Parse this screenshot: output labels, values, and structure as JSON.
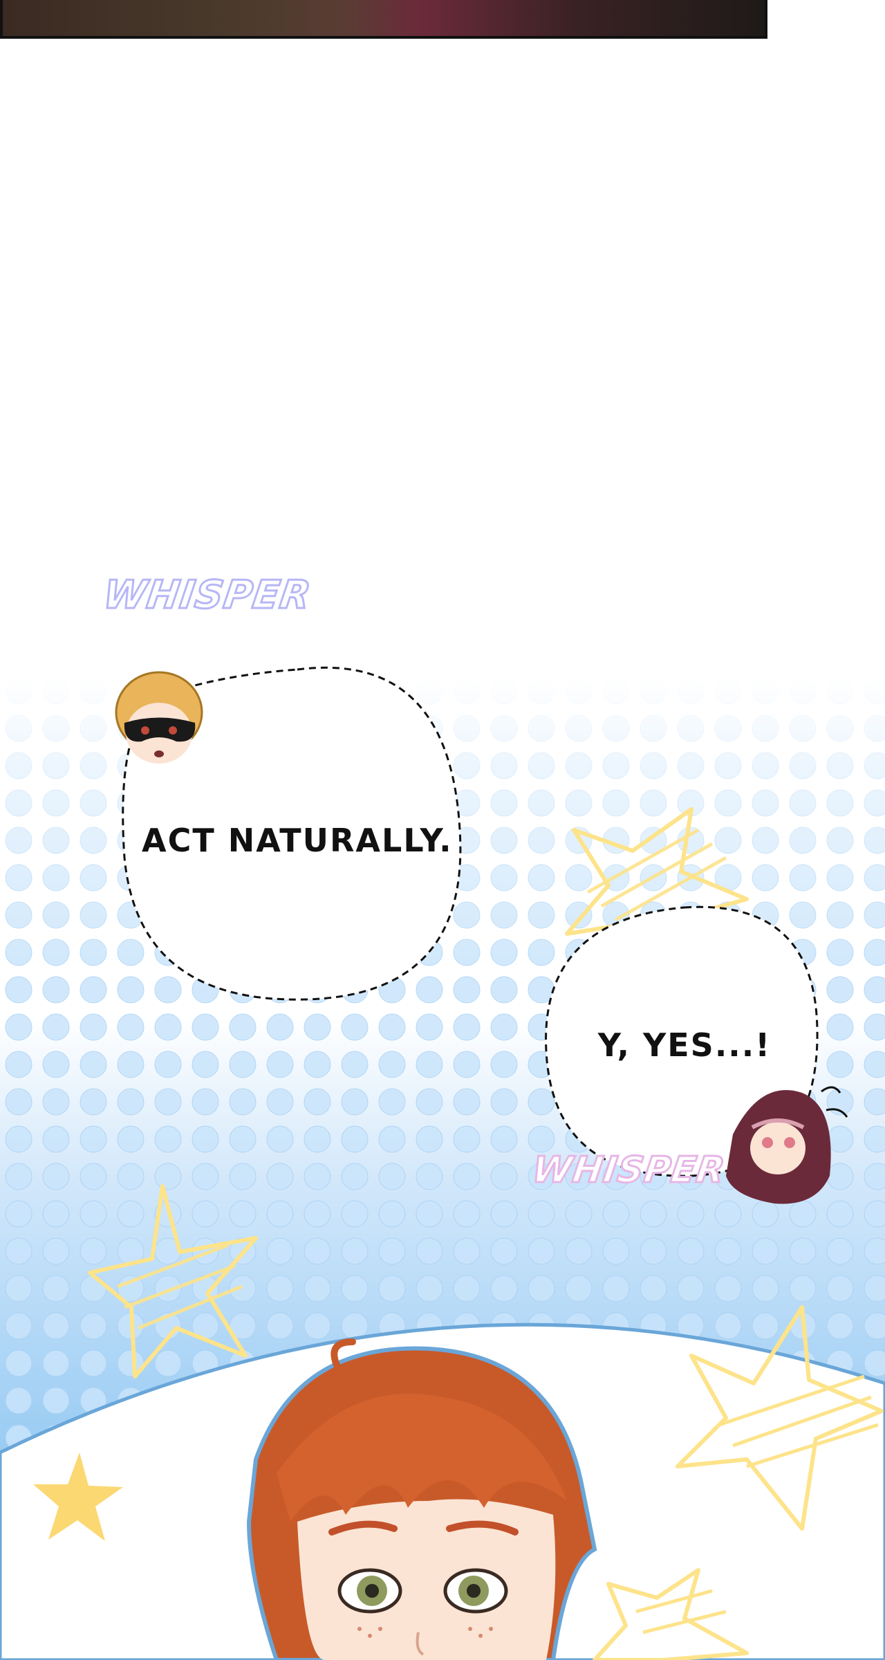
{
  "panel": {
    "bubble_1_text": "ACT NATURALLY.",
    "bubble_2_text": "Y, YES...!",
    "sfx_whisper_1": "WHISPER",
    "sfx_whisper_2": "WHISPER"
  },
  "colors": {
    "background_top": "#ffffff",
    "background_bottom": "#8ec6f2",
    "dots": "#b8dcfb",
    "stars": "#fde38a",
    "whisper_fill": "#ffffff",
    "whisper_outline": "#b6b6f6",
    "hair": "#c85a2a",
    "skin": "#fbe4d4"
  },
  "icons": [
    "small-gold-star-icon",
    "large-outlined-star-icon",
    "masked-chibi-face-icon",
    "hooded-chibi-face-icon"
  ]
}
